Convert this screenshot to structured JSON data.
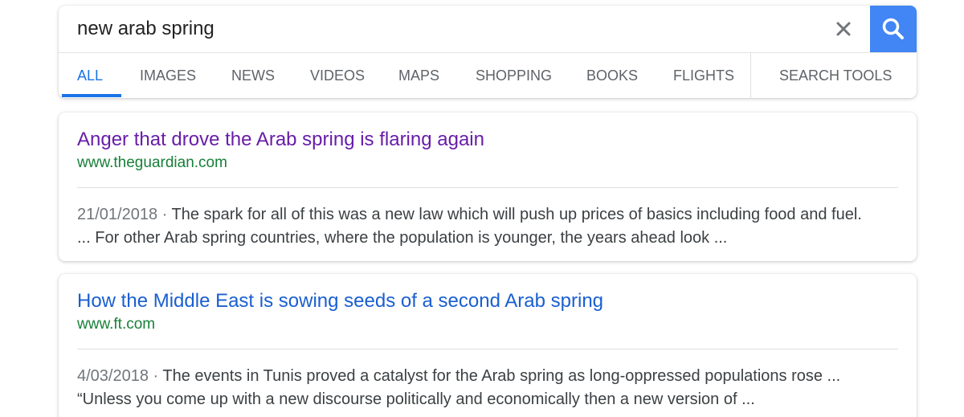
{
  "search": {
    "query": "new arab spring",
    "clear_label": "×",
    "button_color": "#4285f4"
  },
  "tabs": [
    {
      "label": "ALL",
      "active": true
    },
    {
      "label": "IMAGES",
      "active": false
    },
    {
      "label": "NEWS",
      "active": false
    },
    {
      "label": "VIDEOS",
      "active": false
    },
    {
      "label": "MAPS",
      "active": false
    },
    {
      "label": "SHOPPING",
      "active": false
    },
    {
      "label": "BOOKS",
      "active": false
    },
    {
      "label": "FLIGHTS",
      "active": false
    },
    {
      "label": "SEARCH TOOLS",
      "active": false
    }
  ],
  "results": [
    {
      "title": "Anger that drove the Arab spring is flaring again",
      "title_color": "#681da8",
      "url": "www.theguardian.com",
      "date": "21/01/2018 · ",
      "snippet_line1": "The spark for all of this was a new law which will push up prices of basics including food and fuel.",
      "snippet_line2": "... For other Arab spring countries, where the population is younger, the years ahead look ..."
    },
    {
      "title": "How the Middle East is sowing seeds of a second Arab spring",
      "title_color": "#1a5fd0",
      "url": "www.ft.com",
      "date": "4/03/2018 · ",
      "snippet_line1": "The events in Tunis proved a catalyst for the Arab spring as long-oppressed populations rose ...",
      "snippet_line2": "“Unless you come up with a new discourse politically and economically then a new version of ..."
    }
  ],
  "icons": {
    "clear": "close-icon",
    "search": "search-icon"
  }
}
